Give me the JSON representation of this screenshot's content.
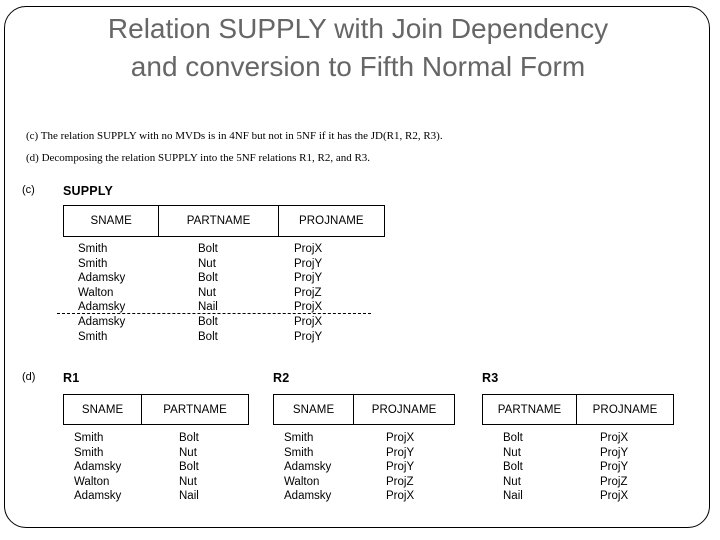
{
  "slide": {
    "title": "Relation SUPPLY with Join Dependency\nand conversion to Fifth Normal Form",
    "title_color": "#666666",
    "border_color": "#000000",
    "captions": {
      "c": "(c) The relation SUPPLY with no MVDs is in 4NF but not in 5NF if it has the JD(R1, R2, R3).",
      "d": "(d) Decomposing the relation SUPPLY into the 5NF relations R1, R2, and R3."
    },
    "part_labels": {
      "c": "(c)",
      "d": "(d)"
    }
  },
  "tables": {
    "supply": {
      "name": "SUPPLY",
      "columns": [
        "SNAME",
        "PARTNAME",
        "PROJNAME"
      ],
      "rows": [
        [
          "Smith",
          "Bolt",
          "ProjX"
        ],
        [
          "Smith",
          "Nut",
          "ProjY"
        ],
        [
          "Adamsky",
          "Bolt",
          "ProjY"
        ],
        [
          "Walton",
          "Nut",
          "ProjZ"
        ],
        [
          "Adamsky",
          "Nail",
          "ProjX"
        ],
        [
          "Adamsky",
          "Bolt",
          "ProjX"
        ],
        [
          "Smith",
          "Bolt",
          "ProjY"
        ]
      ],
      "separator_after_row": 5,
      "col_sname": "Smith\nSmith\nAdamsky\nWalton\nAdamsky\nAdamsky\nSmith",
      "col_partname": "Bolt\nNut\nBolt\nNut\nNail\nBolt\nBolt",
      "col_projname": "ProjX\nProjY\nProjY\nProjZ\nProjX\nProjX\nProjY"
    },
    "r1": {
      "name": "R1",
      "columns": [
        "SNAME",
        "PARTNAME"
      ],
      "rows": [
        [
          "Smith",
          "Bolt"
        ],
        [
          "Smith",
          "Nut"
        ],
        [
          "Adamsky",
          "Bolt"
        ],
        [
          "Walton",
          "Nut"
        ],
        [
          "Adamsky",
          "Nail"
        ]
      ],
      "col_1": "Smith\nSmith\nAdamsky\nWalton\nAdamsky",
      "col_2": "Bolt\nNut\nBolt\nNut\nNail"
    },
    "r2": {
      "name": "R2",
      "columns": [
        "SNAME",
        "PROJNAME"
      ],
      "rows": [
        [
          "Smith",
          "ProjX"
        ],
        [
          "Smith",
          "ProjY"
        ],
        [
          "Adamsky",
          "ProjY"
        ],
        [
          "Walton",
          "ProjZ"
        ],
        [
          "Adamsky",
          "ProjX"
        ]
      ],
      "col_1": "Smith\nSmith\nAdamsky\nWalton\nAdamsky",
      "col_2": "ProjX\nProjY\nProjY\nProjZ\nProjX"
    },
    "r3": {
      "name": "R3",
      "columns": [
        "PARTNAME",
        "PROJNAME"
      ],
      "rows": [
        [
          "Bolt",
          "ProjX"
        ],
        [
          "Nut",
          "ProjY"
        ],
        [
          "Bolt",
          "ProjY"
        ],
        [
          "Nut",
          "ProjZ"
        ],
        [
          "Nail",
          "ProjX"
        ]
      ],
      "col_1": "Bolt\nNut\nBolt\nNut\nNail",
      "col_2": "ProjX\nProjY\nProjY\nProjZ\nProjX"
    }
  }
}
